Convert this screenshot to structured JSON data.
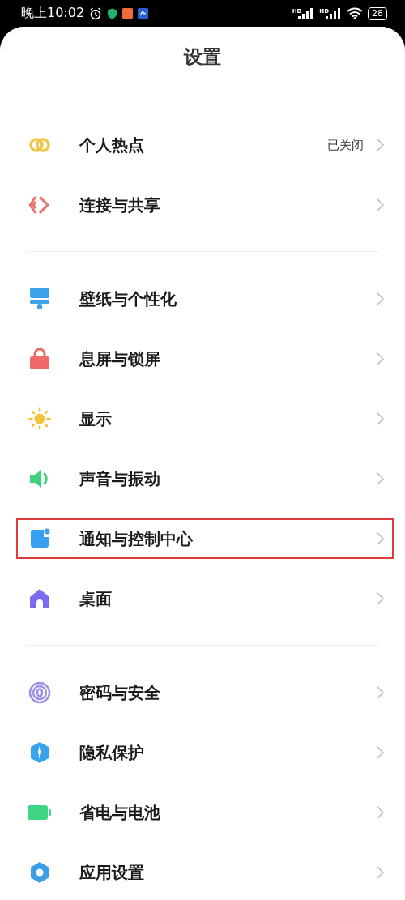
{
  "status_bar": {
    "time": "晚上10:02",
    "network_labels": [
      "HD",
      "HD"
    ],
    "battery": "28"
  },
  "title": "设置",
  "groups": [
    {
      "items": [
        {
          "label": "个人热点",
          "value": "已关闭",
          "highlighted": false
        },
        {
          "label": "连接与共享",
          "highlighted": false
        }
      ]
    },
    {
      "items": [
        {
          "label": "壁纸与个性化",
          "highlighted": false
        },
        {
          "label": "息屏与锁屏",
          "highlighted": false
        },
        {
          "label": "显示",
          "highlighted": false
        },
        {
          "label": "声音与振动",
          "highlighted": false
        },
        {
          "label": "通知与控制中心",
          "highlighted": true
        },
        {
          "label": "桌面",
          "highlighted": false
        }
      ]
    },
    {
      "items": [
        {
          "label": "密码与安全",
          "highlighted": false
        },
        {
          "label": "隐私保护",
          "highlighted": false
        },
        {
          "label": "省电与电池",
          "highlighted": false
        },
        {
          "label": "应用设置",
          "highlighted": false
        }
      ]
    }
  ]
}
